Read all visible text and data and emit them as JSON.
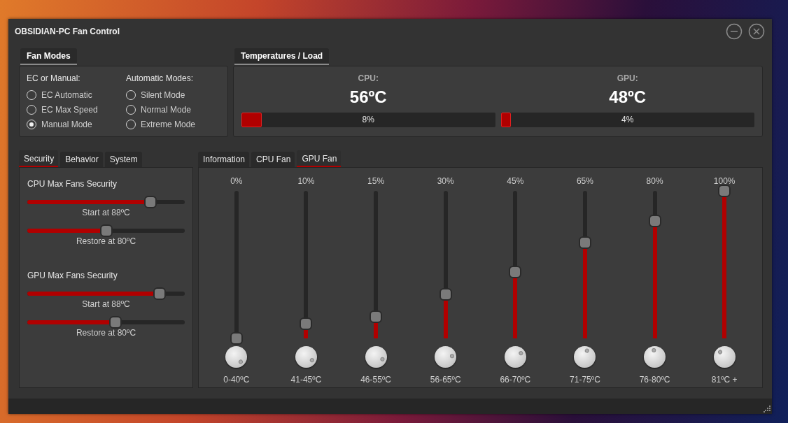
{
  "window": {
    "title": "OBSIDIAN-PC Fan Control"
  },
  "fan_modes": {
    "header": "Fan Modes",
    "groups": [
      {
        "label": "EC or Manual:",
        "options": [
          {
            "label": "EC Automatic",
            "selected": false
          },
          {
            "label": "EC Max Speed",
            "selected": false
          },
          {
            "label": "Manual Mode",
            "selected": true
          }
        ]
      },
      {
        "label": "Automatic Modes:",
        "options": [
          {
            "label": "Silent Mode",
            "selected": false
          },
          {
            "label": "Normal Mode",
            "selected": false
          },
          {
            "label": "Extreme Mode",
            "selected": false
          }
        ]
      }
    ]
  },
  "temperatures": {
    "header": "Temperatures / Load",
    "sensors": [
      {
        "name": "CPU:",
        "temperature": "56ºC",
        "level": 0.08,
        "reading": "8%"
      },
      {
        "name": "GPU:",
        "temperature": "48ºC",
        "level": 0.04,
        "reading": "4%"
      }
    ]
  },
  "settings_tabs": [
    {
      "label": "Security",
      "selected": true
    },
    {
      "label": "Behavior",
      "selected": false
    },
    {
      "label": "System",
      "selected": false
    }
  ],
  "security": [
    {
      "title": "CPU Max Fans Security",
      "sliders": [
        {
          "level": 0.78,
          "reading": "Start at 88ºC"
        },
        {
          "level": 0.5,
          "reading": "Restore at 80ºC"
        }
      ]
    },
    {
      "title": "GPU Max Fans Security",
      "sliders": [
        {
          "level": 0.84,
          "reading": "Start at 88ºC"
        },
        {
          "level": 0.56,
          "reading": "Restore at 80ºC"
        }
      ]
    }
  ],
  "fan_tabs": [
    {
      "label": "Information",
      "selected": false
    },
    {
      "label": "CPU Fan",
      "selected": false
    },
    {
      "label": "GPU Fan",
      "selected": true
    }
  ],
  "fan_curve": [
    {
      "percent": "0%",
      "level": 0,
      "range": "0-40ºC"
    },
    {
      "percent": "10%",
      "level": 0.1,
      "range": "41-45ºC"
    },
    {
      "percent": "15%",
      "level": 0.15,
      "range": "46-55ºC"
    },
    {
      "percent": "30%",
      "level": 0.3,
      "range": "56-65ºC"
    },
    {
      "percent": "45%",
      "level": 0.45,
      "range": "66-70ºC"
    },
    {
      "percent": "65%",
      "level": 0.65,
      "range": "71-75ºC"
    },
    {
      "percent": "80%",
      "level": 0.8,
      "range": "76-80ºC"
    },
    {
      "percent": "100%",
      "level": 1,
      "range": "81ºC +"
    }
  ]
}
